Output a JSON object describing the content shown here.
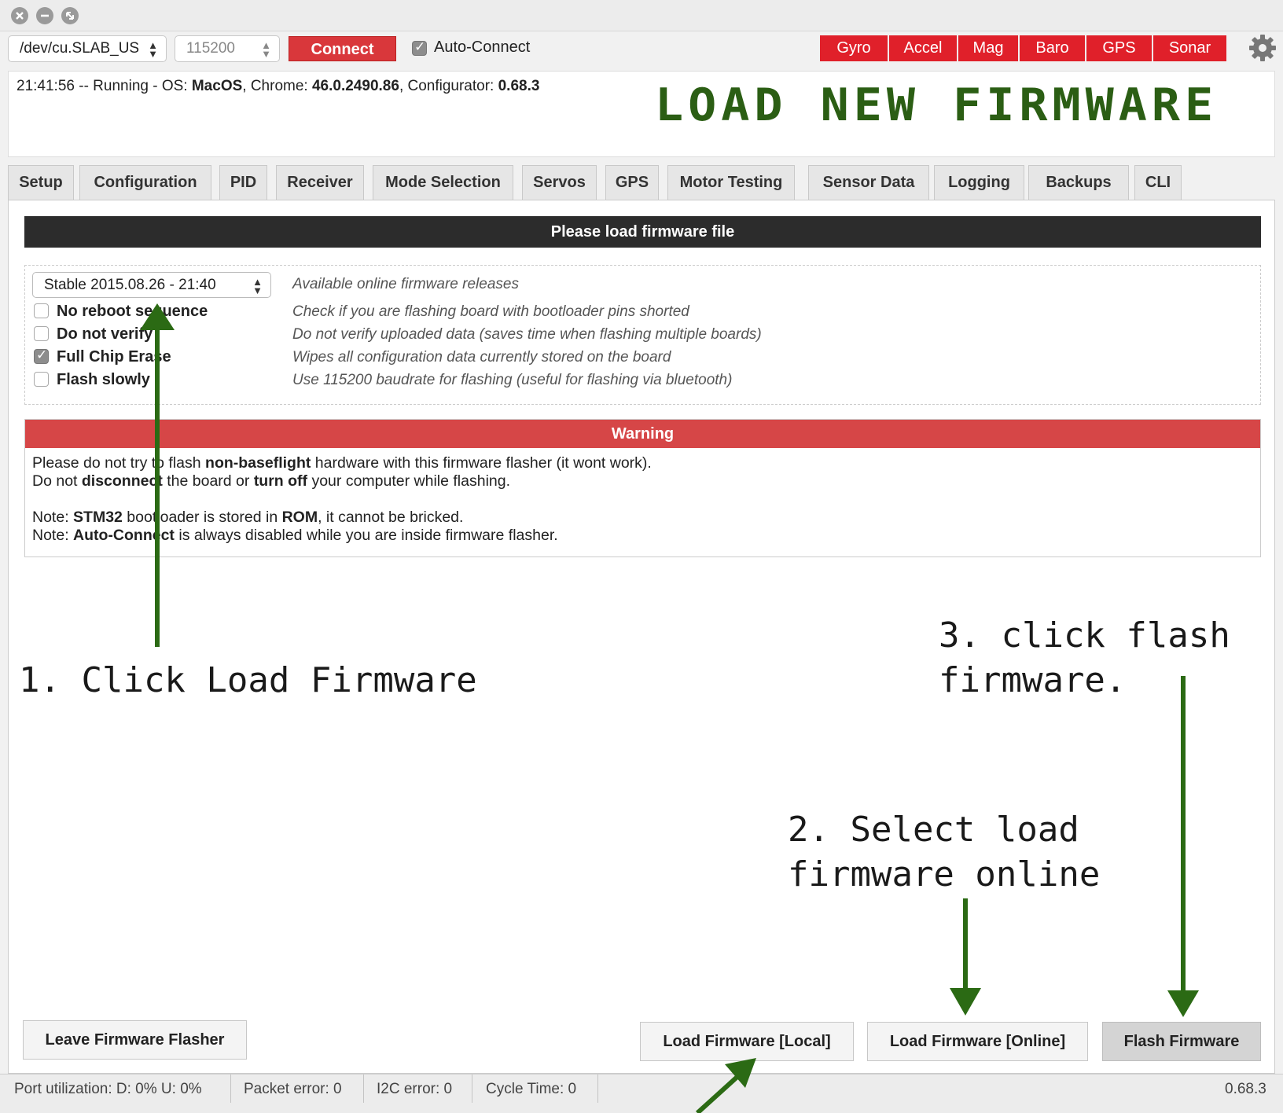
{
  "toolbar": {
    "port": "/dev/cu.SLAB_US",
    "baud": "115200",
    "connect_label": "Connect",
    "auto_connect_label": "Auto-Connect",
    "auto_connect_checked": true,
    "sensors": [
      "Gyro",
      "Accel",
      "Mag",
      "Baro",
      "GPS",
      "Sonar"
    ],
    "sensor_color": "#e0202a",
    "settings_icon": "gear-icon"
  },
  "log": {
    "time": "21:41:56",
    "status": " -- Running - OS: ",
    "os": "MacOS",
    "chrome_label": ", Chrome: ",
    "chrome": "46.0.2490.86",
    "configurator_label": ", Configurator: ",
    "configurator": "0.68.3"
  },
  "banner": {
    "text": "LOAD NEW FIRMWARE",
    "color": "#2b5e14"
  },
  "tabs": [
    "Setup",
    "Configuration",
    "PID",
    "Receiver",
    "Mode Selection",
    "Servos",
    "GPS",
    "Motor Testing",
    "Sensor Data",
    "Logging",
    "Backups",
    "CLI"
  ],
  "flasher": {
    "header": "Please load firmware file",
    "release_select": "Stable 2015.08.26 - 21:40",
    "release_desc": "Available online firmware releases",
    "options": [
      {
        "label": "No reboot sequence",
        "desc": "Check if you are flashing board with bootloader pins shorted",
        "checked": false
      },
      {
        "label": "Do not verify",
        "desc": "Do not verify uploaded data (saves time when flashing multiple boards)",
        "checked": false
      },
      {
        "label": "Full Chip Erase",
        "desc": "Wipes all configuration data currently stored on the board",
        "checked": true
      },
      {
        "label": "Flash slowly",
        "desc": "Use 115200 baudrate for flashing (useful for flashing via bluetooth)",
        "checked": false
      }
    ],
    "warning": {
      "title": "Warning",
      "l1a": "Please do not try to flash ",
      "l1b": "non-baseflight",
      "l1c": " hardware with this firmware flasher (it wont work).",
      "l2a": "Do not ",
      "l2b": "disconnect",
      "l2c": " the board or ",
      "l2d": "turn off",
      "l2e": " your computer while flashing.",
      "l3a": "Note: ",
      "l3b": "STM32",
      "l3c": " bootloader is stored in ",
      "l3d": "ROM",
      "l3e": ", it cannot be bricked.",
      "l4a": "Note: ",
      "l4b": "Auto-Connect",
      "l4c": " is always disabled while you are inside firmware flasher."
    },
    "buttons": {
      "leave": "Leave Firmware Flasher",
      "load_local": "Load Firmware [Local]",
      "load_online": "Load Firmware [Online]",
      "flash": "Flash Firmware"
    }
  },
  "annotations": {
    "step1": "1. Click Load Firmware",
    "step2_l1": "2. Select load",
    "step2_l2": "firmware online",
    "step3_l1": "3. click flash",
    "step3_l2": "firmware.",
    "arrow_color": "#2b6a14"
  },
  "statusbar": {
    "port_util": "Port utilization: D: 0% U: 0%",
    "packet_error": "Packet error: 0",
    "i2c_error": "I2C error: 0",
    "cycle_time": "Cycle Time: 0",
    "version": "0.68.3"
  }
}
